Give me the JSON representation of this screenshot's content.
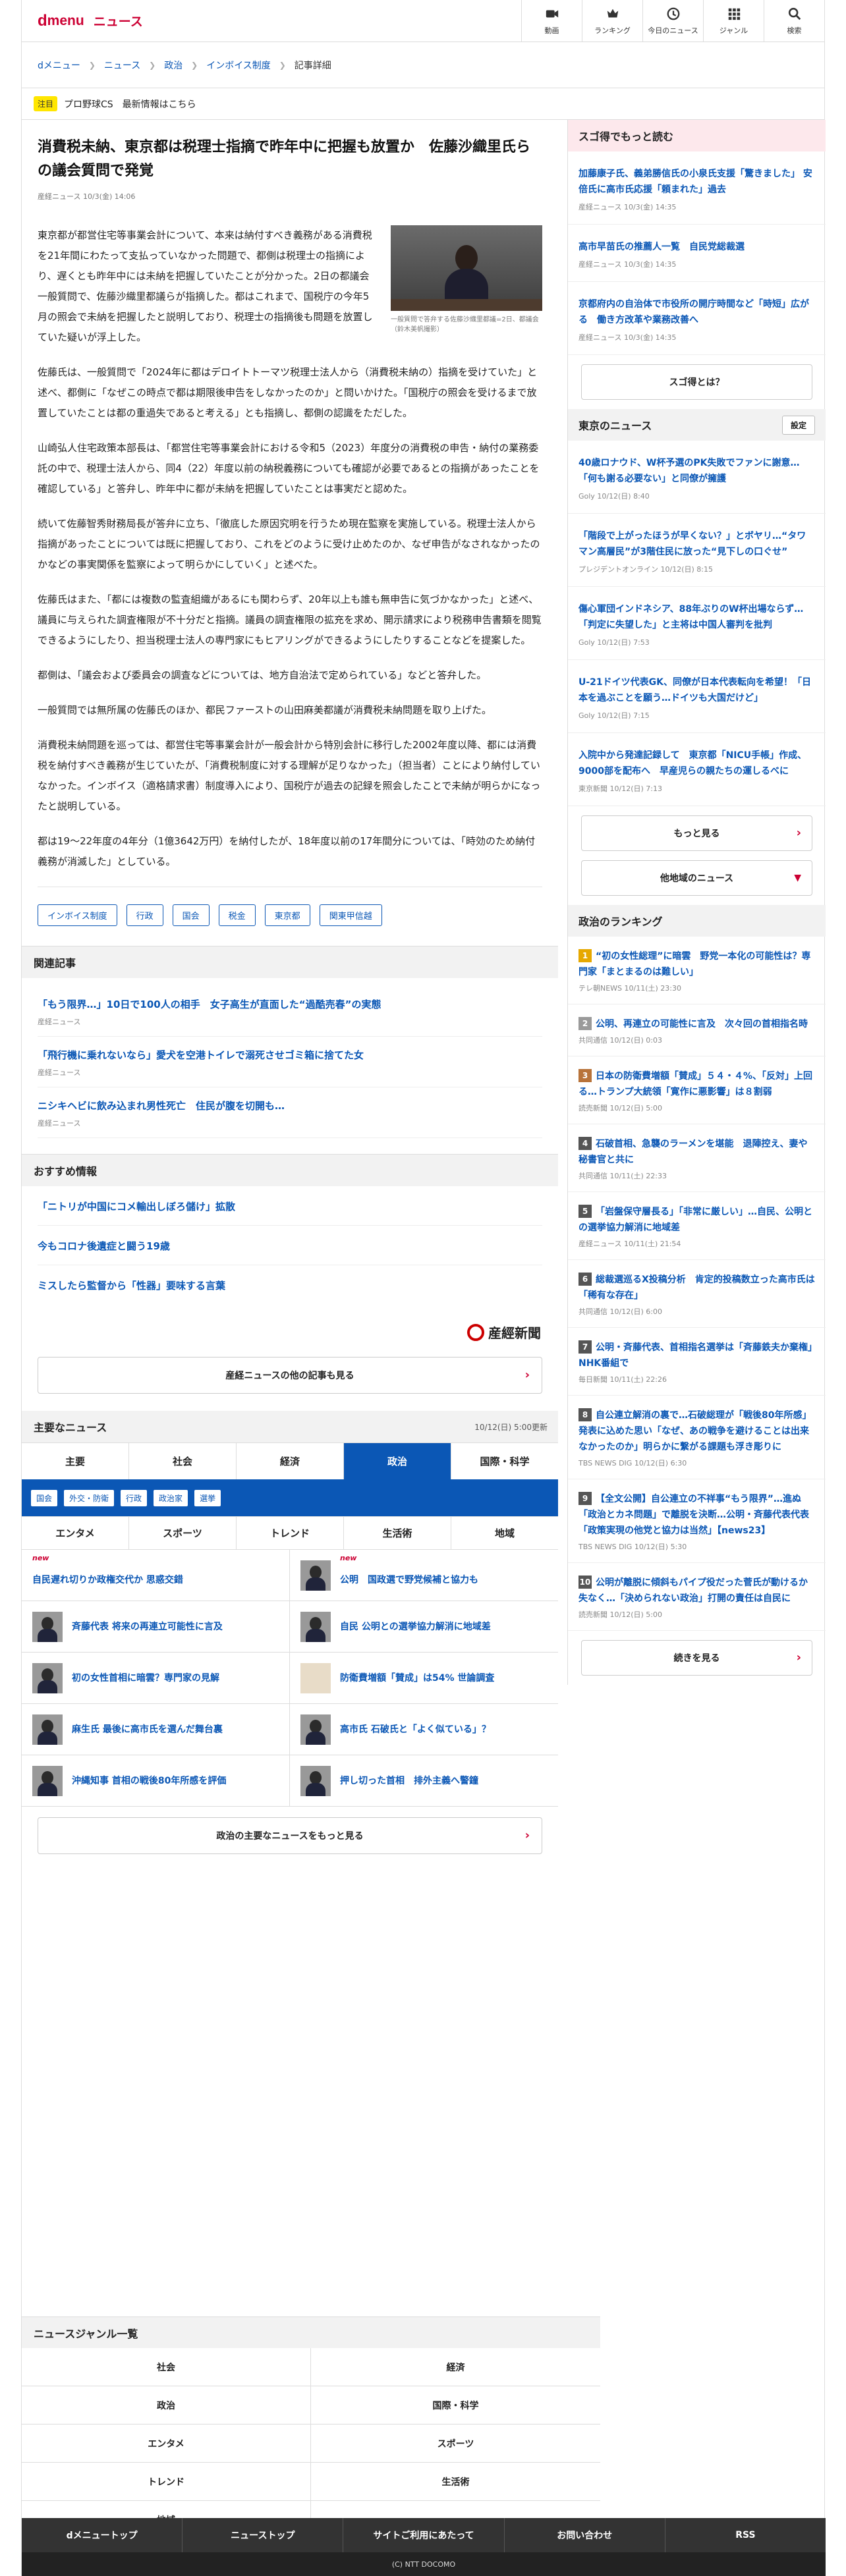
{
  "header": {
    "logo_d": "d",
    "logo_menu": "menu",
    "logo_news": "ニュース",
    "nav": [
      {
        "label": "動画",
        "icon": "video-icon"
      },
      {
        "label": "ランキング",
        "icon": "crown-icon"
      },
      {
        "label": "今日のニュース",
        "icon": "clock-icon"
      },
      {
        "label": "ジャンル",
        "icon": "grid-icon"
      },
      {
        "label": "検索",
        "icon": "search-icon"
      }
    ]
  },
  "breadcrumb": [
    "dメニュー",
    "ニュース",
    "政治",
    "インボイス制度",
    "記事詳細"
  ],
  "notice": {
    "badge": "注目",
    "text": "プロ野球CS　最新情報はこちら"
  },
  "article": {
    "title": "消費税未納、東京都は税理士指摘で昨年中に把握も放置か　佐藤沙織里氏らの議会質問で発覚",
    "meta": "産経ニュース 10/3(金) 14:06",
    "caption": "一般質問で答弁する佐藤沙織里都議=2日、都議会（鈴木美帆撮影）",
    "paragraphs": [
      "東京都が都営住宅等事業会計について、本来は納付すべき義務がある消費税を21年間にわたって支払っていなかった問題で、都側は税理士の指摘により、遅くとも昨年中には未納を把握していたことが分かった。2日の都議会一般質問で、佐藤沙織里都議らが指摘した。都はこれまで、国税庁の今年5月の照会で未納を把握したと説明しており、税理士の指摘後も問題を放置していた疑いが浮上した。",
      "佐藤氏は、一般質問で「2024年に都はデロイトトーマツ税理士法人から（消費税未納の）指摘を受けていた」と述べ、都側に「なぜこの時点で都は期限後申告をしなかったのか」と問いかけた。「国税庁の照会を受けるまで放置していたことは都の重過失であると考える」とも指摘し、都側の認識をただした。",
      "山崎弘人住宅政策本部長は、「都営住宅等事業会計における令和5（2023）年度分の消費税の申告・納付の業務委託の中で、税理士法人から、同4（22）年度以前の納税義務についても確認が必要であるとの指摘があったことを確認している」と答弁し、昨年中に都が未納を把握していたことは事実だと認めた。",
      "続いて佐藤智秀財務局長が答弁に立ち、「徹底した原因究明を行うため現在監察を実施している。税理士法人から指摘があったことについては既に把握しており、これをどのように受け止めたのか、なぜ申告がなされなかったのかなどの事実関係を監察によって明らかにしていく」と述べた。",
      "佐藤氏はまた、「都には複数の監査組織があるにも関わらず、20年以上も誰も無申告に気づかなかった」と述べ、議員に与えられた調査権限が不十分だと指摘。議員の調査権限の拡充を求め、開示請求により税務申告書類を閲覧できるようにしたり、担当税理士法人の専門家にもヒアリングができるようにしたりすることなどを提案した。",
      "都側は、「議会および委員会の調査などについては、地方自治法で定められている」などと答弁した。",
      "一般質問では無所属の佐藤氏のほか、都民ファーストの山田麻美都議が消費税未納問題を取り上げた。",
      "消費税未納問題を巡っては、都営住宅等事業会計が一般会計から特別会計に移行した2002年度以降、都には消費税を納付すべき義務が生じていたが、「消費税制度に対する理解が足りなかった」（担当者）ことにより納付していなかった。インボイス（適格請求書）制度導入により、国税庁が過去の記録を照会したことで未納が明らかになったと説明している。",
      "都は19～22年度の4年分（1億3642万円）を納付したが、18年度以前の17年間分については、「時効のため納付義務が消滅した」としている。"
    ],
    "tags": [
      "インボイス制度",
      "行政",
      "国会",
      "税金",
      "東京都",
      "関東甲信越"
    ]
  },
  "related": {
    "heading": "関連記事",
    "items": [
      {
        "title": "「もう限界…」10日で100人の相手　女子高生が直面した“過酷売春”の実態",
        "src": "産経ニュース"
      },
      {
        "title": "「飛行機に乗れないなら」愛犬を空港トイレで溺死させゴミ箱に捨てた女",
        "src": "産経ニュース"
      },
      {
        "title": "ニシキヘビに飲み込まれ男性死亡　住民が腹を切開も…",
        "src": "産経ニュース"
      }
    ]
  },
  "recommend": {
    "heading": "おすすめ情報",
    "items": [
      "「ニトリが中国にコメ輸出しぼろ儲け」拡散",
      "今もコロナ後遺症と闘う19歳",
      "ミスしたら監督から「性器」要味する言葉"
    ]
  },
  "sankei": {
    "logo": "産經新聞",
    "more": "産経ニュースの他の記事も見る"
  },
  "main_news": {
    "heading": "主要なニュース",
    "updated": "10/12(日) 5:00更新",
    "tabs": [
      "主要",
      "社会",
      "経済",
      "政治",
      "国際・科学"
    ],
    "subcats": [
      "国会",
      "外交・防衛",
      "行政",
      "政治家",
      "選挙"
    ],
    "tabs2": [
      "エンタメ",
      "スポーツ",
      "トレンド",
      "生活術",
      "地域"
    ],
    "items": [
      {
        "title": "自民遅れ切りか政権交代か 思惑交錯",
        "new": "new",
        "thumb": false
      },
      {
        "title": "公明　国政選で野党候補と協力も",
        "new": "new",
        "thumb": true
      },
      {
        "title": "斉藤代表 将来の再連立可能性に言及",
        "new": "",
        "thumb": true
      },
      {
        "title": "自民 公明との選挙協力解消に地域差",
        "new": "",
        "thumb": true
      },
      {
        "title": "初の女性首相に暗雲？専門家の見解",
        "new": "",
        "thumb": true
      },
      {
        "title": "防衛費増額「賛成」は54% 世論調査",
        "new": "",
        "thumb": true
      },
      {
        "title": "麻生氏 最後に高市氏を選んだ舞台裏",
        "new": "",
        "thumb": true
      },
      {
        "title": "高市氏 石破氏と「よく似ている」？",
        "new": "",
        "thumb": true
      },
      {
        "title": "沖縄知事 首相の戦後80年所感を評価",
        "new": "",
        "thumb": true
      },
      {
        "title": "押し切った首相　排外主義へ警鐘",
        "new": "",
        "thumb": true
      }
    ],
    "more": "政治の主要なニュースをもっと見る"
  },
  "genre": {
    "heading": "ニュースジャンル一覧",
    "items": [
      "社会",
      "経済",
      "政治",
      "国際・科学",
      "エンタメ",
      "スポーツ",
      "トレンド",
      "生活術",
      "地域"
    ]
  },
  "footer": {
    "nav": [
      "dメニュートップ",
      "ニューストップ",
      "サイトご利用にあたって",
      "お問い合わせ",
      "RSS"
    ],
    "copyright": "(C) NTT DOCOMO"
  },
  "sidebar": {
    "deals_heading": "スゴ得でもっと読む",
    "deals": [
      {
        "title": "加藤康子氏、義弟勝信氏の小泉氏支援「驚きました」 安倍氏に高市氏応援「頼まれた」過去",
        "src": "産経ニュース 10/3(金) 14:35"
      },
      {
        "title": "高市早苗氏の推薦人一覧　自民党総裁選",
        "src": "産経ニュース 10/3(金) 14:35"
      },
      {
        "title": "京都府内の自治体で市役所の開庁時間など「時短」広がる　働き方改革や業務改善へ",
        "src": "産経ニュース 10/3(金) 14:35"
      }
    ],
    "deals_btn": "スゴ得とは？",
    "tokyo_heading": "東京のニュース",
    "tokyo_setting": "設定",
    "tokyo": [
      {
        "title": "40歳ロナウド、W杯予選のPK失敗でファンに謝意…「何も謝る必要ない」と同僚が擁護",
        "src": "Goly 10/12(日) 8:40"
      },
      {
        "title": "「階段で上がったほうが早くない？」とボヤリ…“タワマン高層民”が3階住民に放った“見下しの口ぐせ”",
        "src": "プレジデントオンライン 10/12(日) 8:15"
      },
      {
        "title": "傷心軍団インドネシア、88年ぶりのW杯出場ならず…「判定に失望した」と主将は中国人審判を批判",
        "src": "Goly 10/12(日) 7:53"
      },
      {
        "title": "U-21ドイツ代表GK、同僚が日本代表転向を希望！「日本を過ぶことを願う…ドイツも大国だけど」",
        "src": "Goly 10/12(日) 7:15"
      },
      {
        "title": "入院中から発達記録して　東京都「NICU手帳」作成、9000部を配布へ　早産児らの親たちの運しるべに",
        "src": "東京新聞 10/12(日) 7:13"
      }
    ],
    "tokyo_more": "もっと見る",
    "other_area": "他地域のニュース",
    "ranking_heading": "政治のランキング",
    "ranking": [
      {
        "n": "1",
        "title": "“初の女性総理”に暗雲　野党一本化の可能性は？専門家「まとまるのは難しい」",
        "src": "テレ朝NEWS 10/11(土) 23:30",
        "color": "#e6a800"
      },
      {
        "title": "公明、再連立の可能性に言及　次々回の首相指名時",
        "n": "2",
        "src": "共同通信 10/12(日) 0:03",
        "color": "#9a9a9a"
      },
      {
        "n": "3",
        "title": "日本の防衛費増額「賛成」５４・４%、「反対」上回る…トランプ大統領「寛作に悪影響」は８割弱",
        "src": "読売新聞 10/12(日) 5:00",
        "color": "#b8733a"
      },
      {
        "n": "4",
        "title": "石破首相、急襲のラーメンを堪能　退陣控え、妻や秘書官と共に",
        "src": "共同通信 10/11(土) 22:33",
        "color": "#555"
      },
      {
        "n": "5",
        "title": "「岩盤保守層長る」「非常に厳しい」…自民、公明との選挙協力解消に地域差",
        "src": "産経ニュース 10/11(土) 21:54",
        "color": "#555"
      },
      {
        "n": "6",
        "title": "総裁選巡るX投稿分析　肯定的投稿数立った高市氏は「稀有な存在」",
        "src": "共同通信 10/12(日) 6:00",
        "color": "#555"
      },
      {
        "n": "7",
        "title": "公明・斉藤代表、首相指名選挙は「斉藤鉄夫か棄権」　NHK番組で",
        "src": "毎日新聞 10/11(土) 22:26",
        "color": "#555"
      },
      {
        "n": "8",
        "title": "自公連立解消の裏で…石破総理が「戦後80年所感」発表に込めた思い「なぜ、あの戦争を避けることは出来なかったのか」明らかに繋がる課題も浮き彫りに",
        "src": "TBS NEWS DIG 10/12(日) 6:30",
        "color": "#555"
      },
      {
        "n": "9",
        "title": "【全文公開】自公連立の不祥事“もう限界”…進ぬ「政治とカネ問題」で離脱を決断…公明・斉藤代表代表「政策実現の他党と協力は当然」【news23】",
        "src": "TBS NEWS DIG 10/12(日) 5:30",
        "color": "#555"
      },
      {
        "n": "10",
        "title": "公明が離脱に傾斜もパイプ役だった菅氏が動けるか失なく…「決められない政治」打開の責任は自民に",
        "src": "読売新聞 10/12(日) 5:00",
        "color": "#555"
      }
    ],
    "ranking_more": "続きを見る"
  }
}
